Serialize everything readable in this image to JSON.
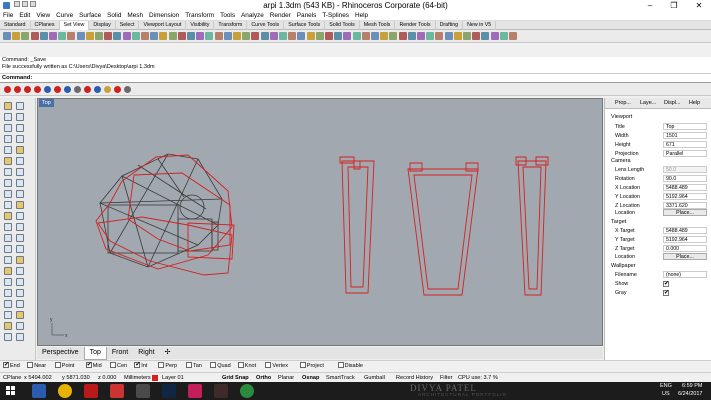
{
  "window": {
    "title": "arpi 1.3dm (543 KB) - Rhinoceros Corporate (64-bit)",
    "minimize": "–",
    "maximize": "❐",
    "close": "✕"
  },
  "menu": [
    "File",
    "Edit",
    "View",
    "Curve",
    "Surface",
    "Solid",
    "Mesh",
    "Dimension",
    "Transform",
    "Tools",
    "Analyze",
    "Render",
    "Panels",
    "T-Splines",
    "Help"
  ],
  "toolbar_tabs": [
    "Standard",
    "CPlanes",
    "Set View",
    "Display",
    "Select",
    "Viewport Layout",
    "Visibility",
    "Transform",
    "Curve Tools",
    "Surface Tools",
    "Solid Tools",
    "Mesh Tools",
    "Render Tools",
    "Drafting",
    "New in V5"
  ],
  "toolbar_tabs_active": "Set View",
  "command_history": [
    "Command: _Save",
    "File successfully written as C:\\Users\\Divya\\Desktop\\arpi 1.3dm"
  ],
  "command_prompt": "Command:",
  "viewport": {
    "label": "Top",
    "tabs": [
      "Perspective",
      "Top",
      "Front",
      "Right"
    ],
    "active_tab": "Top",
    "add_tab": "✢",
    "axis_x": "x",
    "axis_y": "y"
  },
  "osnap": [
    {
      "label": "End",
      "checked": true
    },
    {
      "label": "Near",
      "checked": false
    },
    {
      "label": "Point",
      "checked": false
    },
    {
      "label": "Mid",
      "checked": true
    },
    {
      "label": "Cen",
      "checked": false
    },
    {
      "label": "Int",
      "checked": true
    },
    {
      "label": "Perp",
      "checked": false
    },
    {
      "label": "Tan",
      "checked": false
    },
    {
      "label": "Quad",
      "checked": false
    },
    {
      "label": "Knot",
      "checked": false
    },
    {
      "label": "Vertex",
      "checked": false
    },
    {
      "label": "Project",
      "checked": false
    },
    {
      "label": "Disable",
      "checked": false
    }
  ],
  "status": {
    "cplane": "CPlane",
    "x": "x 5494.002",
    "y": "y 5871.030",
    "z": "z 0.000",
    "units": "Millimeters",
    "layer": "Layer 01",
    "grid_snap": "Grid Snap",
    "ortho": "Ortho",
    "planar": "Planar",
    "osnap": "Osnap",
    "smarttrack": "SmartTrack",
    "gumball": "Gumball",
    "record_history": "Record History",
    "filter": "Filter",
    "cpu": "CPU use: 3.7 %"
  },
  "panel": {
    "tabs": [
      "Prop...",
      "Laye...",
      "Displ...",
      "Help"
    ],
    "viewport_section": "Viewport",
    "fields": [
      {
        "label": "Title",
        "value": "Top"
      },
      {
        "label": "Width",
        "value": "1501"
      },
      {
        "label": "Height",
        "value": "671"
      },
      {
        "label": "Projection",
        "value": "Parallel"
      }
    ],
    "camera_section": "Camera",
    "camera": [
      {
        "label": "Lens Length",
        "value": "50.0",
        "grey": true
      },
      {
        "label": "Rotation",
        "value": "90.0"
      },
      {
        "label": "X Location",
        "value": "5488.489"
      },
      {
        "label": "Y Location",
        "value": "5192.964"
      },
      {
        "label": "Z Location",
        "value": "3371.620"
      }
    ],
    "location_label": "Location",
    "place_button": "Place...",
    "target_section": "Target",
    "target": [
      {
        "label": "X Target",
        "value": "5488.489"
      },
      {
        "label": "Y Target",
        "value": "5192.964"
      },
      {
        "label": "Z Target",
        "value": "0.000"
      }
    ],
    "wallpaper_section": "Wallpaper",
    "wallpaper": [
      {
        "label": "Filename",
        "value": "(none)"
      },
      {
        "label": "Show",
        "value": "✔"
      },
      {
        "label": "Gray",
        "value": "✔"
      }
    ]
  },
  "taskbar": {
    "lang_top": "ENG",
    "lang_bottom": "US",
    "time": "6:59 PM",
    "date": "6/24/2017",
    "watermark_title": "DIVYA PATEL",
    "watermark_sub": "ARCHITECTURAL PORTFOLIO"
  },
  "colors": {
    "viewport_bg": "#a1a8b0",
    "curve_red": "#d42020",
    "curve_dark": "#3a3a3a"
  }
}
